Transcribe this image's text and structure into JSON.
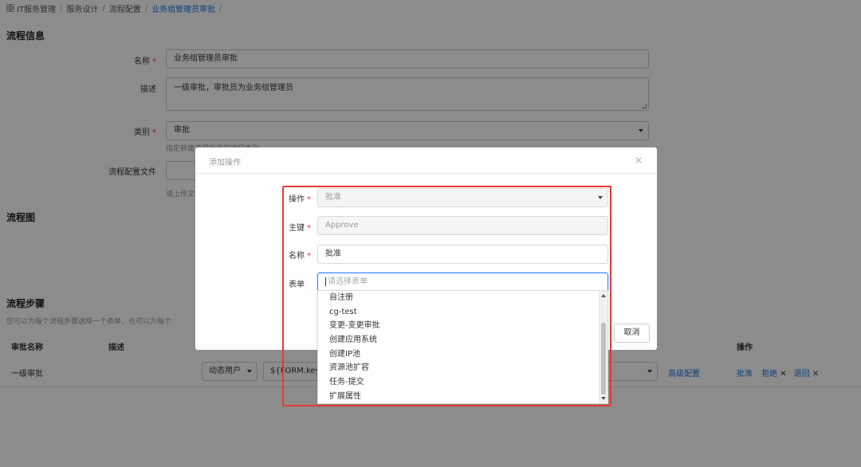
{
  "breadcrumb": {
    "items": [
      "IT服务管理",
      "服务设计",
      "流程配置"
    ],
    "current": "业务组管理员审批",
    "trailing": "/"
  },
  "process_info": {
    "title": "流程信息",
    "name_label": "名称",
    "name_value": "业务组管理员审批",
    "desc_label": "描述",
    "desc_value": "一级审批，审批员为业务组管理员",
    "category_label": "类别",
    "category_value": "审批",
    "category_hint": "指定新建流程所属的流程类别",
    "file_label": "流程配置文件",
    "file_hint": "请上传文"
  },
  "diagram": {
    "title": "流程图"
  },
  "steps": {
    "title": "流程步骤",
    "description": "您可以为每个流程步骤选择一个表单，也可以为每个",
    "headers": {
      "name": "审批名称",
      "desc": "描述",
      "ops": "操作"
    },
    "row": {
      "name": "一级审批",
      "user_type": "动态用户",
      "user_key": "${FORM.key}",
      "advanced": "高级配置",
      "approve": "批准",
      "reject": "拒绝",
      "return": "退回",
      "remove_mark": "✕"
    }
  },
  "modal": {
    "title": "添加操作",
    "close": "×",
    "fields": {
      "operation": {
        "label": "操作",
        "value": "批准"
      },
      "key": {
        "label": "主键",
        "value": "Approve"
      },
      "name": {
        "label": "名称",
        "value": "批准"
      },
      "form": {
        "label": "表单",
        "placeholder": "请选择表单"
      }
    },
    "required_mark": "*",
    "dropdown_options": [
      "自注册",
      "cg-test",
      "变更-变更审批",
      "创建应用系统",
      "创建IP池",
      "资源池扩容",
      "任务-提交",
      "扩展属性"
    ],
    "cancel_label": "取消"
  },
  "colors": {
    "accent": "#1a73e8",
    "required": "#e53935",
    "highlight": "#e53935"
  }
}
